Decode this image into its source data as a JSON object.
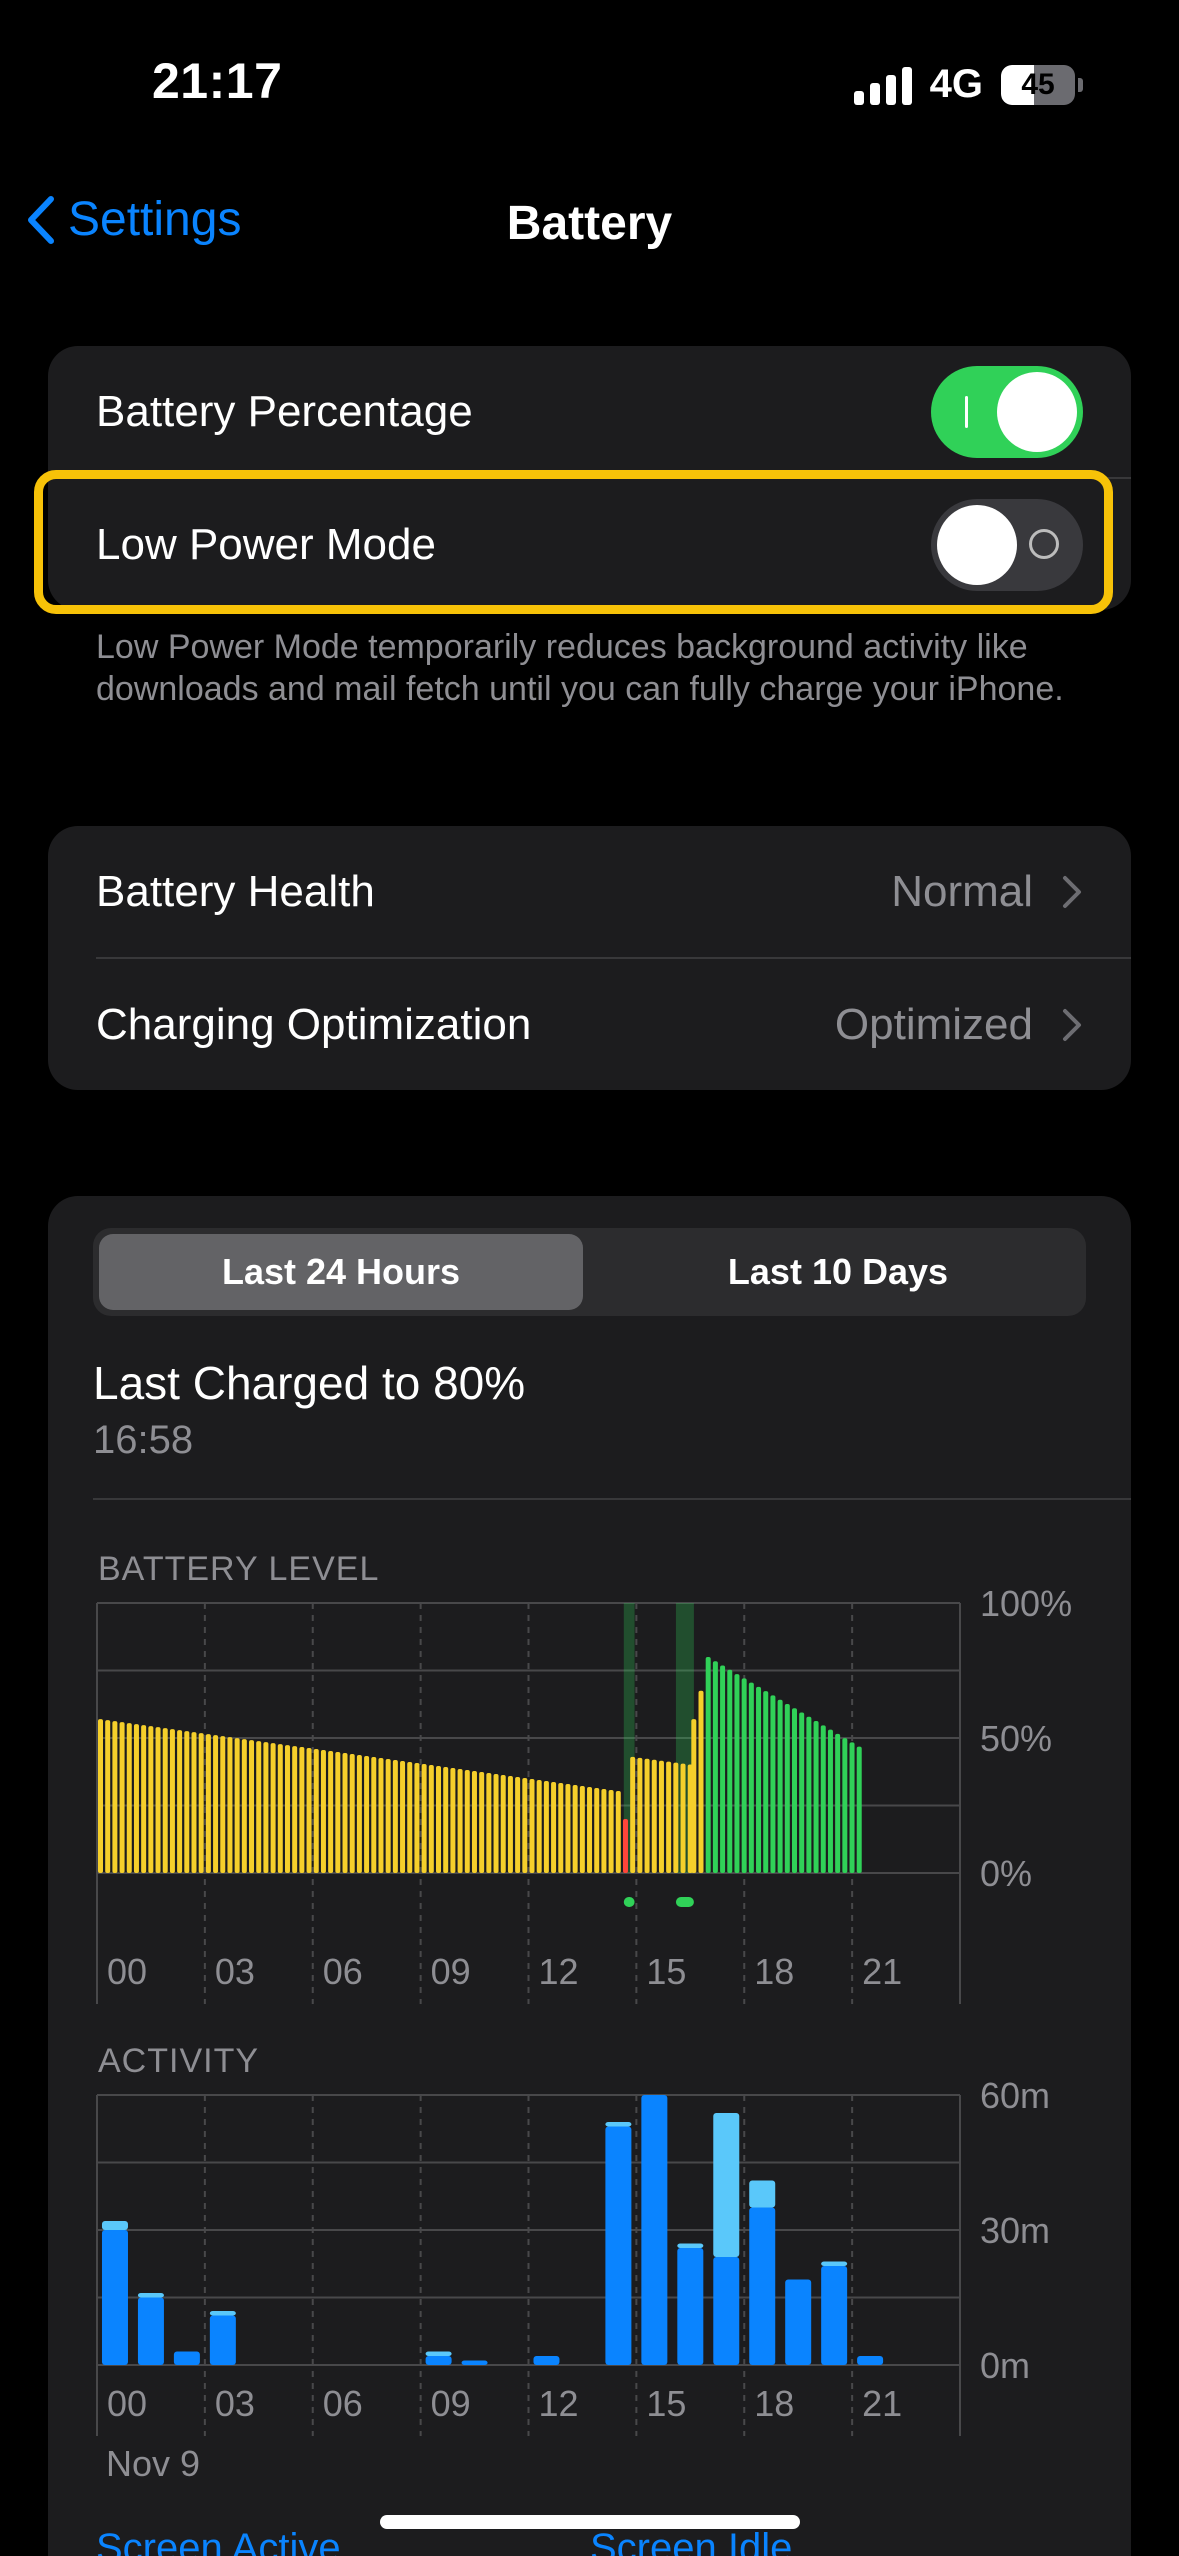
{
  "status_bar": {
    "time": "21:17",
    "network": "4G",
    "battery_percent": "45",
    "battery_level": 0.45,
    "signal_bars": 4
  },
  "nav": {
    "back_label": "Settings",
    "title": "Battery"
  },
  "toggles_group": {
    "battery_percentage": {
      "label": "Battery Percentage",
      "on": true
    },
    "low_power_mode": {
      "label": "Low Power Mode",
      "on": false
    },
    "footnote": "Low Power Mode temporarily reduces background activity like downloads and mail fetch until you can fully charge your iPhone."
  },
  "health_group": {
    "battery_health": {
      "label": "Battery Health",
      "value": "Normal"
    },
    "charging_optimization": {
      "label": "Charging Optimization",
      "value": "Optimized"
    }
  },
  "usage": {
    "tabs": [
      "Last 24 Hours",
      "Last 10 Days"
    ],
    "active_tab": 0,
    "last_charged_title": "Last Charged to 80%",
    "last_charged_time": "16:58",
    "battery_level_label": "BATTERY LEVEL",
    "activity_label": "ACTIVITY",
    "date_label": "Nov 9",
    "legend": {
      "screen_active": "Screen Active",
      "screen_idle": "Screen Idle"
    }
  },
  "colors": {
    "accent": "#0a84ff",
    "toggle_on": "#30d158",
    "highlight": "#f7c208",
    "battery_normal": "#f5cf2b",
    "battery_charging": "#30d158",
    "battery_low": "#ff453a",
    "screen_active": "#0a84ff",
    "screen_idle": "#5ac8fa"
  },
  "chart_data": [
    {
      "type": "bar",
      "title": "BATTERY LEVEL",
      "x_ticks": [
        "00",
        "03",
        "06",
        "09",
        "12",
        "15",
        "18",
        "21"
      ],
      "y_ticks": [
        "100%",
        "50%",
        "0%"
      ],
      "ylim": [
        0,
        100
      ],
      "x_unit": "hours",
      "series": [
        {
          "segments": [
            {
              "start_hour": 0.0,
              "end_hour": 14.6,
              "start_level": 57,
              "end_level": 30,
              "state": "normal"
            },
            {
              "start_hour": 14.6,
              "end_hour": 14.8,
              "start_level": 20,
              "end_level": 18,
              "state": "low"
            },
            {
              "start_hour": 14.8,
              "end_hour": 16.5,
              "start_level": 43,
              "end_level": 40,
              "state": "normal"
            },
            {
              "start_hour": 16.5,
              "end_hour": 16.9,
              "start_level": 57,
              "end_level": 78,
              "state": "normal"
            },
            {
              "start_hour": 16.9,
              "end_hour": 21.2,
              "start_level": 80,
              "end_level": 46,
              "state": "charging"
            }
          ]
        }
      ],
      "charging_periods": [
        [
          14.65,
          14.95
        ],
        [
          16.1,
          16.6
        ]
      ]
    },
    {
      "type": "bar",
      "title": "ACTIVITY",
      "x_ticks": [
        "00",
        "03",
        "06",
        "09",
        "12",
        "15",
        "18",
        "21"
      ],
      "y_ticks": [
        "60m",
        "30m",
        "0m"
      ],
      "ylim": [
        0,
        60
      ],
      "categories": [
        "00:00",
        "01:00",
        "02:00",
        "03:00",
        "04:00",
        "05:00",
        "06:00",
        "07:00",
        "08:00",
        "09:00",
        "10:00",
        "11:00",
        "12:00",
        "13:00",
        "14:00",
        "15:00",
        "16:00",
        "17:00",
        "18:00",
        "19:00",
        "20:00",
        "21:00"
      ],
      "series": [
        {
          "name": "Screen Active",
          "values": [
            30,
            15,
            3,
            11,
            0,
            0,
            0,
            0,
            0,
            2,
            1,
            0,
            2,
            0,
            53,
            60,
            26,
            24,
            35,
            19,
            22,
            2
          ]
        },
        {
          "name": "Screen Idle",
          "values": [
            2,
            1,
            0,
            1,
            0,
            0,
            0,
            0,
            0,
            1,
            0,
            0,
            0,
            0,
            1,
            0,
            1,
            32,
            6,
            0,
            1,
            0
          ]
        }
      ],
      "xlabel": "Nov 9"
    }
  ]
}
